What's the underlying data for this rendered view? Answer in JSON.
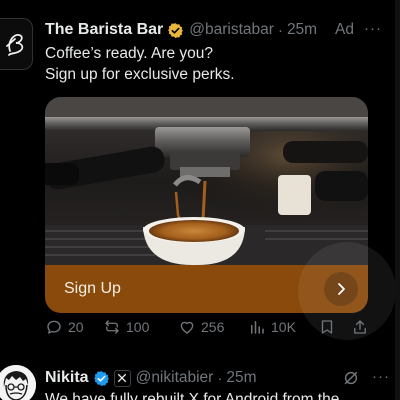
{
  "ad_post": {
    "author_name": "The Barista Bar",
    "handle": "@baristabar",
    "separator": "·",
    "time": "25m",
    "ad_label": "Ad",
    "more": "···",
    "text_line1": "Coffee’s ready. Are you?",
    "text_line2": "Sign up for exclusive perks.",
    "card": {
      "image": "espresso-machine-photo",
      "cta_label": "Sign Up",
      "cta_icon": "chevron-right-icon"
    },
    "actions": {
      "replies": "20",
      "reposts": "100",
      "likes": "256",
      "views": "10K"
    }
  },
  "next_post": {
    "author_name": "Nikita",
    "handle": "@nikitabier",
    "separator": "·",
    "time": "25m",
    "more": "···",
    "text": "We have fully rebuilt X for Android from the"
  },
  "colors": {
    "background": "#000000",
    "text_primary": "#e7e9ea",
    "text_secondary": "#71767b",
    "verified_gold": "#e8b73b",
    "verified_blue": "#1d9bf0",
    "cta_background": "#8a4a0b"
  }
}
